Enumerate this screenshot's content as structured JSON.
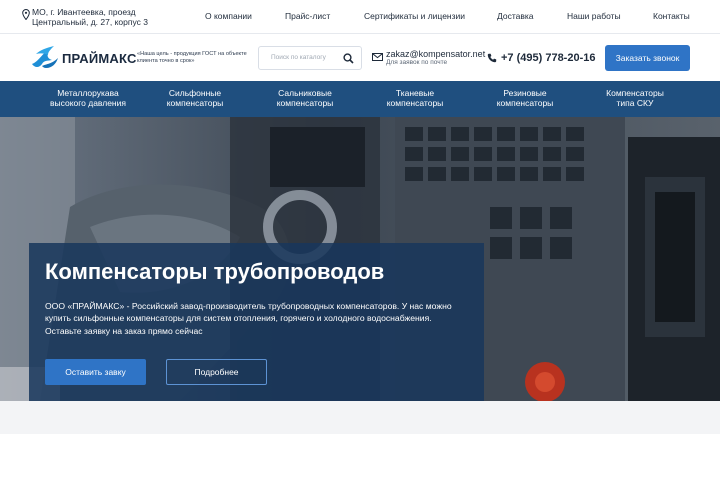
{
  "topbar": {
    "address_line1": "МО, г. Ивантеевка, проезд",
    "address_line2": "Центральный, д. 27, корпус 3",
    "nav": [
      "О компании",
      "Прайс-лист",
      "Сертификаты и лицензии",
      "Доставка",
      "Наши работы",
      "Контакты"
    ]
  },
  "header": {
    "logo_text": "ПРАЙМАКС",
    "slogan": "«Наша цель - продукция ГОСТ на объекте клиента точно в срок»",
    "search_placeholder": "Поиск по каталогу",
    "email": "zakaz@kompensator.net",
    "email_sub": "Для заявок по почте",
    "phone": "+7 (495) 778-20-16",
    "call_button": "Заказать звонок"
  },
  "catnav": [
    {
      "line1": "Металлорукава",
      "line2": "высокого давления"
    },
    {
      "line1": "Сильфонные",
      "line2": "компенсаторы"
    },
    {
      "line1": "Сальниковые",
      "line2": "компенсаторы"
    },
    {
      "line1": "Тканевые",
      "line2": "компенсаторы"
    },
    {
      "line1": "Резиновые",
      "line2": "компенсаторы"
    },
    {
      "line1": "Компенсаторы",
      "line2": "типа СКУ"
    }
  ],
  "hero": {
    "title": "Компенсаторы трубопроводов",
    "description": "ООО «ПРАЙМАКС» - Российский завод-производитель трубопроводных компенсаторов. У нас можно купить сильфонные компенсаторы для систем отопления, горячего и холодного водоснабжения. Оставьте заявку на заказ прямо сейчас",
    "primary_button": "Оставить завку",
    "secondary_button": "Подробнее"
  },
  "colors": {
    "accent": "#2f74c6",
    "nav_bg": "#1f4f7f",
    "panel_bg": "#18375c"
  },
  "icons": [
    "location-pin-icon",
    "search-icon",
    "mail-icon",
    "phone-icon",
    "brand-logo-icon"
  ]
}
